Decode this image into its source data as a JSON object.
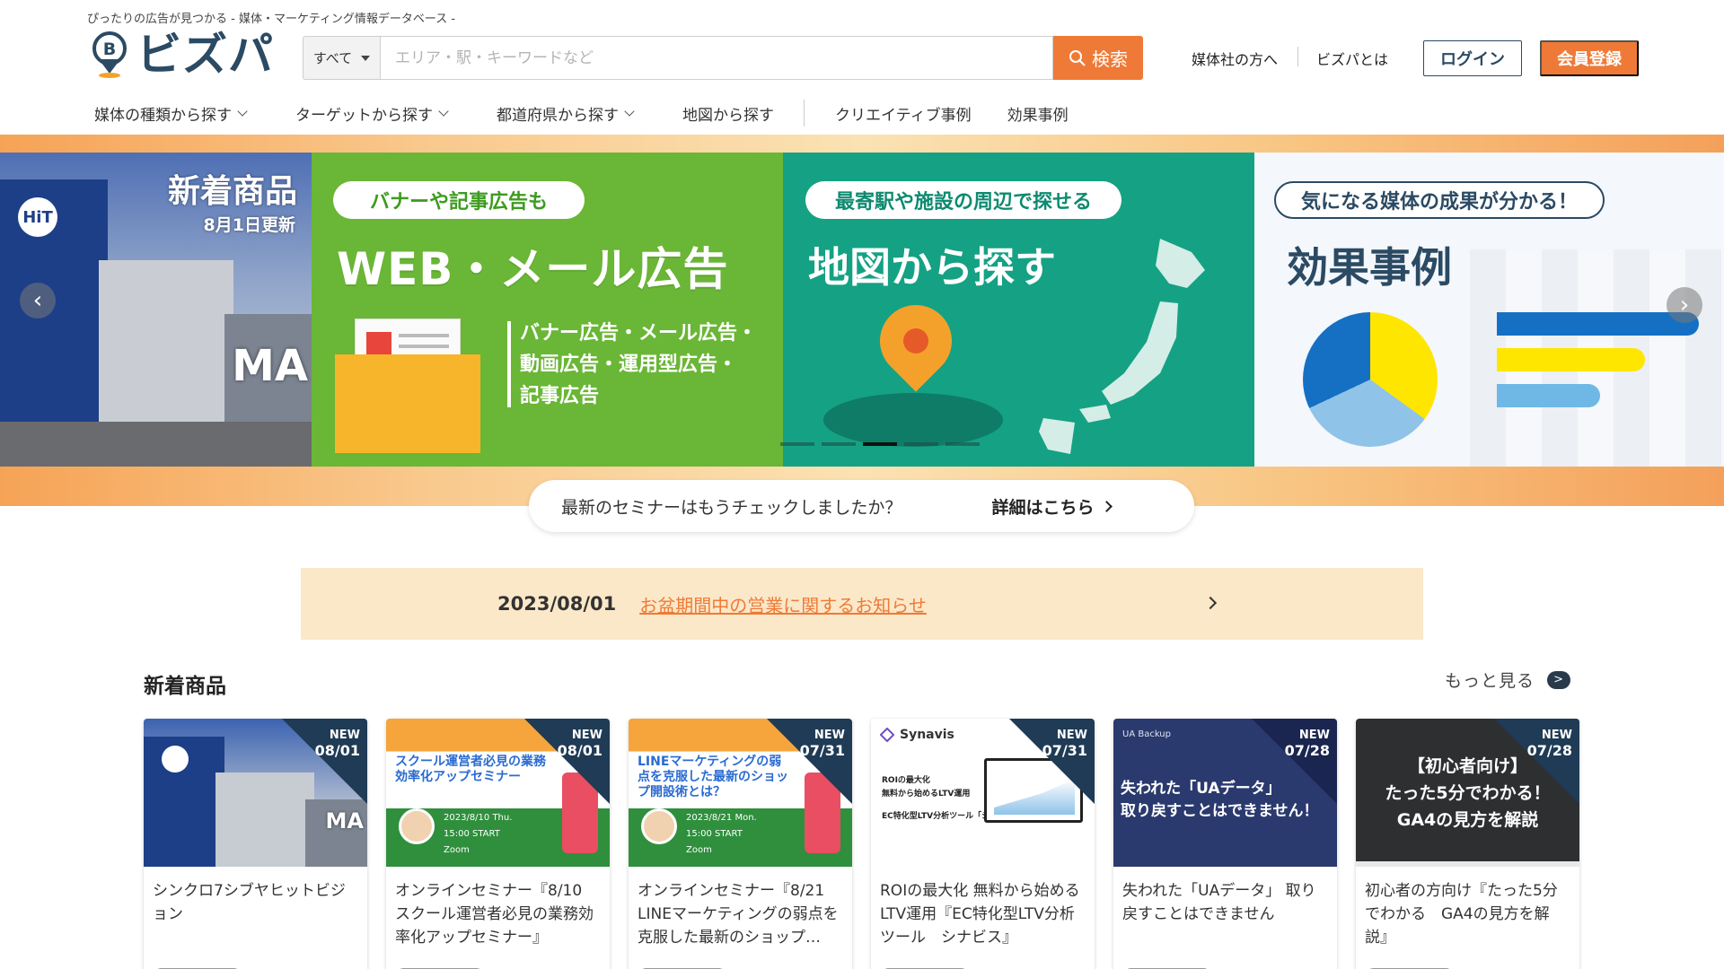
{
  "header": {
    "tagline": "ぴったりの広告が見つかる - 媒体・マーケティング情報データベース -",
    "logo_text": "ビズパ",
    "logo_letter": "B",
    "search": {
      "category": "すべて",
      "placeholder": "エリア・駅・キーワードなど",
      "button_label": "検索"
    },
    "links": {
      "media_company": "媒体社の方へ",
      "about": "ビズパとは"
    },
    "login_label": "ログイン",
    "register_label": "会員登録"
  },
  "nav": {
    "items": [
      {
        "label": "媒体の種類から探す",
        "dropdown": true
      },
      {
        "label": "ターゲットから探す",
        "dropdown": true
      },
      {
        "label": "都道府県から探す",
        "dropdown": true
      },
      {
        "label": "地図から探す",
        "dropdown": false
      },
      {
        "label": "クリエイティブ事例",
        "dropdown": false
      },
      {
        "label": "効果事例",
        "dropdown": false
      }
    ]
  },
  "hero": {
    "slides": [
      {
        "title": "新着商品",
        "subtitle": "8月1日更新",
        "sign_text": "MA",
        "logo_text": "HiT"
      },
      {
        "bubble": "バナーや記事広告も",
        "title": "WEB・メール広告",
        "list": [
          "バナー広告・メール広告・",
          "動画広告・運用型広告・",
          "記事広告"
        ]
      },
      {
        "bubble": "最寄駅や施設の周辺で探せる",
        "title": "地図から探す"
      },
      {
        "bubble": "気になる媒体の成果が分かる！",
        "title": "効果事例"
      }
    ],
    "active_dot": 2,
    "dot_count": 5,
    "prev_icon": "‹",
    "next_icon": "›",
    "seminar": {
      "text": "最新のセミナーはもうチェックしましたか？",
      "link_label": "詳細はこちら"
    }
  },
  "notice": {
    "date": "2023/08/01",
    "title": "お盆期間中の営業に関するお知らせ"
  },
  "new_products": {
    "section_title": "新着商品",
    "more_label": "もっと見る",
    "more_icon": ">",
    "cards": [
      {
        "badge": "NEW",
        "date": "08/01",
        "title": "シンクロ7シブヤヒットビジョン",
        "image": "city"
      },
      {
        "badge": "NEW",
        "date": "08/01",
        "title": "オンラインセミナー『8/10 スクール運営者必見の業務効率化アップセミナー』",
        "image": "seminar",
        "image_head": "スクール運営者必見の業務効率化アップセミナー",
        "image_info": [
          "2023/8/10 Thu.",
          "15:00 START",
          "Zoom"
        ]
      },
      {
        "badge": "NEW",
        "date": "07/31",
        "title": "オンラインセミナー『8/21 LINEマーケティングの弱点を克服した最新のショップ…",
        "image": "seminar",
        "image_head": "LINEマーケティングの弱点を克服した最新のショップ開設術とは？",
        "image_info": [
          "2023/8/21 Mon.",
          "15:00 START",
          "Zoom"
        ]
      },
      {
        "badge": "NEW",
        "date": "07/31",
        "title": "ROIの最大化 無料から始めるLTV運用『EC特化型LTV分析ツール　シナビス』",
        "image": "synavis",
        "image_logo": "Synavis",
        "image_text": [
          "ROIの最大化",
          "無料から始めるLTV運用",
          "EC特化型LTV分析ツール「シナビス」"
        ]
      },
      {
        "badge": "NEW",
        "date": "07/28",
        "title": "失われた「UAデータ」 取り戻すことはできません",
        "image": "ua",
        "image_small": "UA Backup",
        "image_text": [
          "失われた「UAデータ」",
          "取り戻すことはできません！"
        ]
      },
      {
        "badge": "NEW",
        "date": "07/28",
        "title": "初心者の方向け『たった5分でわかる　GA4の見方を解説』",
        "image": "ga",
        "image_text": [
          "【初心者向け】",
          "たった5分でわかる！",
          "GA4の見方を解説"
        ]
      }
    ]
  },
  "colors": {
    "accent": "#ef7a37",
    "brand_navy": "#2b4a63",
    "notice_bg": "#fbe8c9"
  }
}
